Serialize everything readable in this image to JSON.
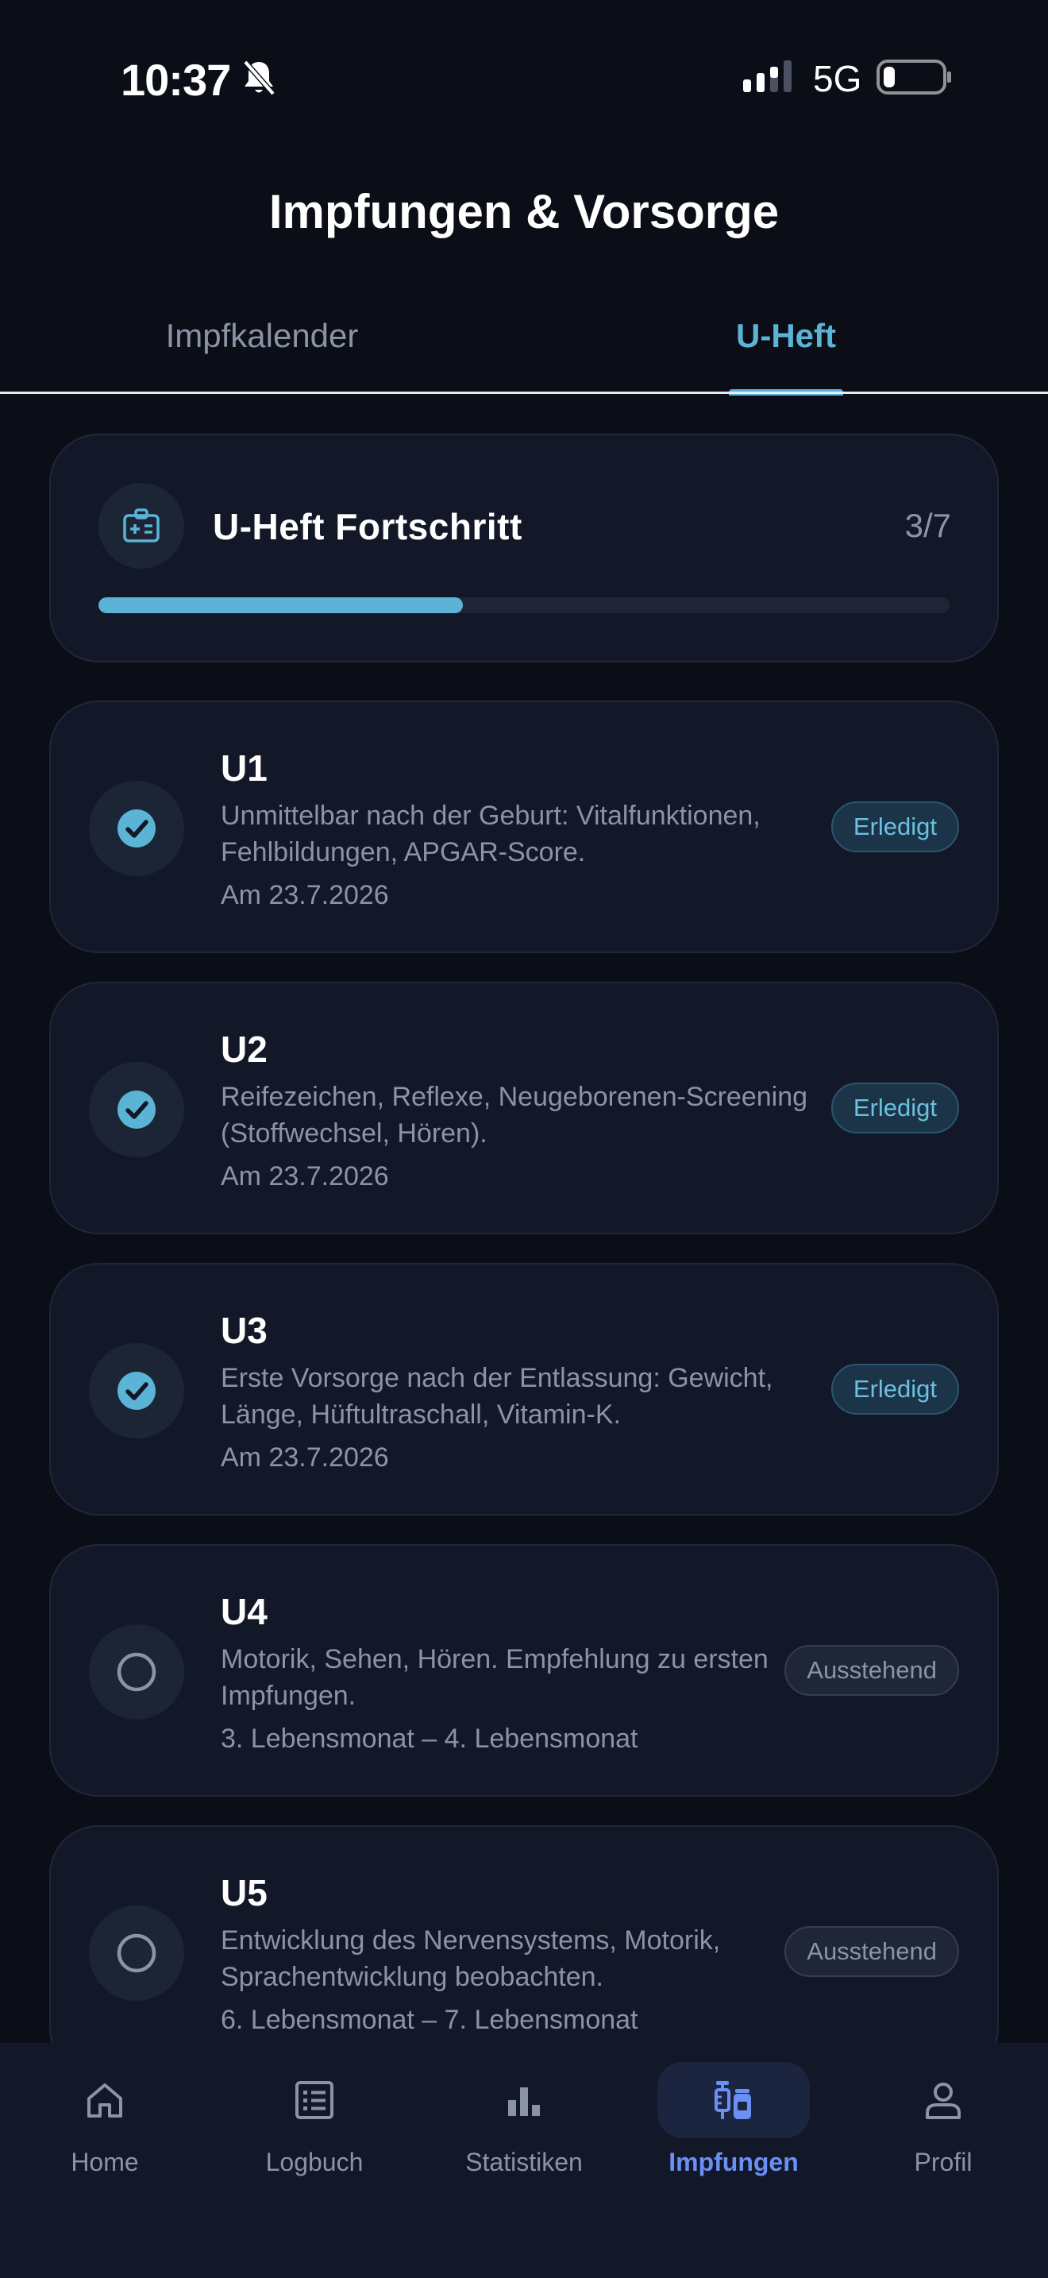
{
  "status_bar": {
    "time": "10:37",
    "network": "5G"
  },
  "header": {
    "title": "Impfungen & Vorsorge"
  },
  "tabs": [
    {
      "label": "Impfkalender",
      "active": false
    },
    {
      "label": "U-Heft",
      "active": true
    }
  ],
  "progress": {
    "title": "U-Heft Fortschritt",
    "count_label": "3/7",
    "completed": 3,
    "total": 7
  },
  "exams": [
    {
      "name": "U1",
      "description": "Unmittelbar nach der Geburt: Vitalfunktionen, Fehlbildungen, APGAR-Score.",
      "date": "Am 23.7.2026",
      "status": "Erledigt",
      "done": true
    },
    {
      "name": "U2",
      "description": "Reifezeichen, Reflexe, Neugeborenen-Screening (Stoffwechsel, Hören).",
      "date": "Am 23.7.2026",
      "status": "Erledigt",
      "done": true
    },
    {
      "name": "U3",
      "description": "Erste Vorsorge nach der Entlassung: Gewicht, Länge, Hüftultraschall, Vitamin-K.",
      "date": "Am 23.7.2026",
      "status": "Erledigt",
      "done": true
    },
    {
      "name": "U4",
      "description": "Motorik, Sehen, Hören. Empfehlung zu ersten Impfungen.",
      "date": "3. Lebensmonat – 4. Lebensmonat",
      "status": "Ausstehend",
      "done": false
    },
    {
      "name": "U5",
      "description": "Entwicklung des Nervensystems, Motorik, Sprachentwicklung beobachten.",
      "date": "6. Lebensmonat – 7. Lebensmonat",
      "status": "Ausstehend",
      "done": false
    }
  ],
  "bottom_nav": [
    {
      "label": "Home",
      "icon": "home-icon",
      "active": false
    },
    {
      "label": "Logbuch",
      "icon": "list-icon",
      "active": false
    },
    {
      "label": "Statistiken",
      "icon": "bar-chart-icon",
      "active": false
    },
    {
      "label": "Impfungen",
      "icon": "syringe-vial-icon",
      "active": true
    },
    {
      "label": "Profil",
      "icon": "person-icon",
      "active": false
    }
  ],
  "colors": {
    "background": "#0b0e16",
    "card": "#121827",
    "accent": "#5bb4d6",
    "nav_active": "#6b8ff5",
    "muted_text": "#8b93a6"
  }
}
